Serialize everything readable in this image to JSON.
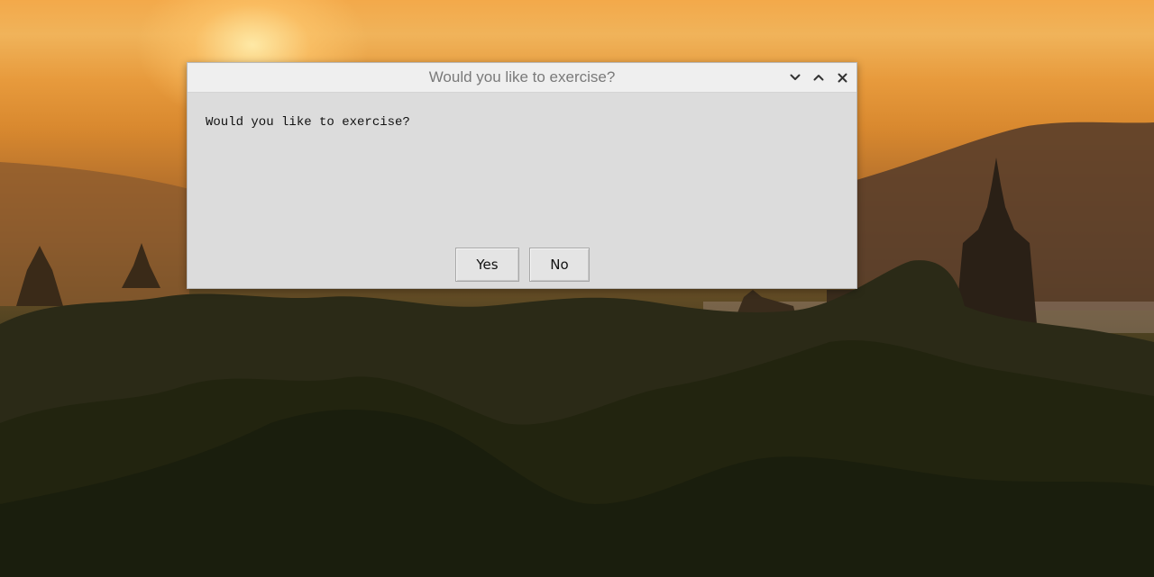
{
  "dialog": {
    "title": "Would you like to exercise?",
    "message": "Would you like to exercise?",
    "buttons": {
      "yes": "Yes",
      "no": "No"
    },
    "window_controls": [
      "chevron-down-icon",
      "chevron-up-icon",
      "close-icon"
    ]
  },
  "colors": {
    "dialog_bg": "#dcdcdc",
    "titlebar_bg": "#efefef",
    "title_text": "#7a7a7a"
  }
}
